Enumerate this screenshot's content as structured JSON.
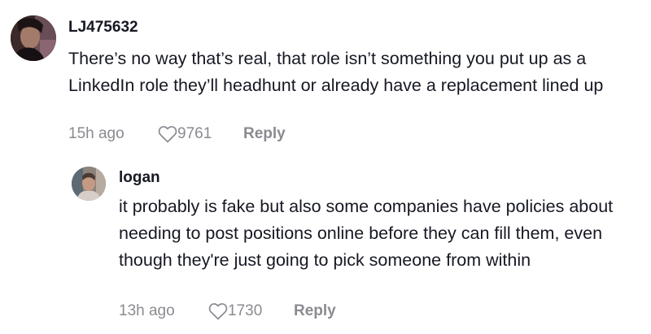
{
  "comments": [
    {
      "username": "LJ475632",
      "text": "There’s no way that’s real, that role isn’t something you put up as a LinkedIn role they’ll headhunt or already have a replacement lined up",
      "time": "15h ago",
      "likes": "9761",
      "reply_label": "Reply"
    },
    {
      "username": "logan",
      "text": "it probably is fake but also some companies have policies about needing to post positions online before they can fill them, even though they're just going to pick someone from within",
      "time": "13h ago",
      "likes": "1730",
      "reply_label": "Reply"
    }
  ],
  "colors": {
    "text": "#161823",
    "meta": "#8a8b91"
  },
  "icons": {
    "like": "heart-outline-icon"
  }
}
